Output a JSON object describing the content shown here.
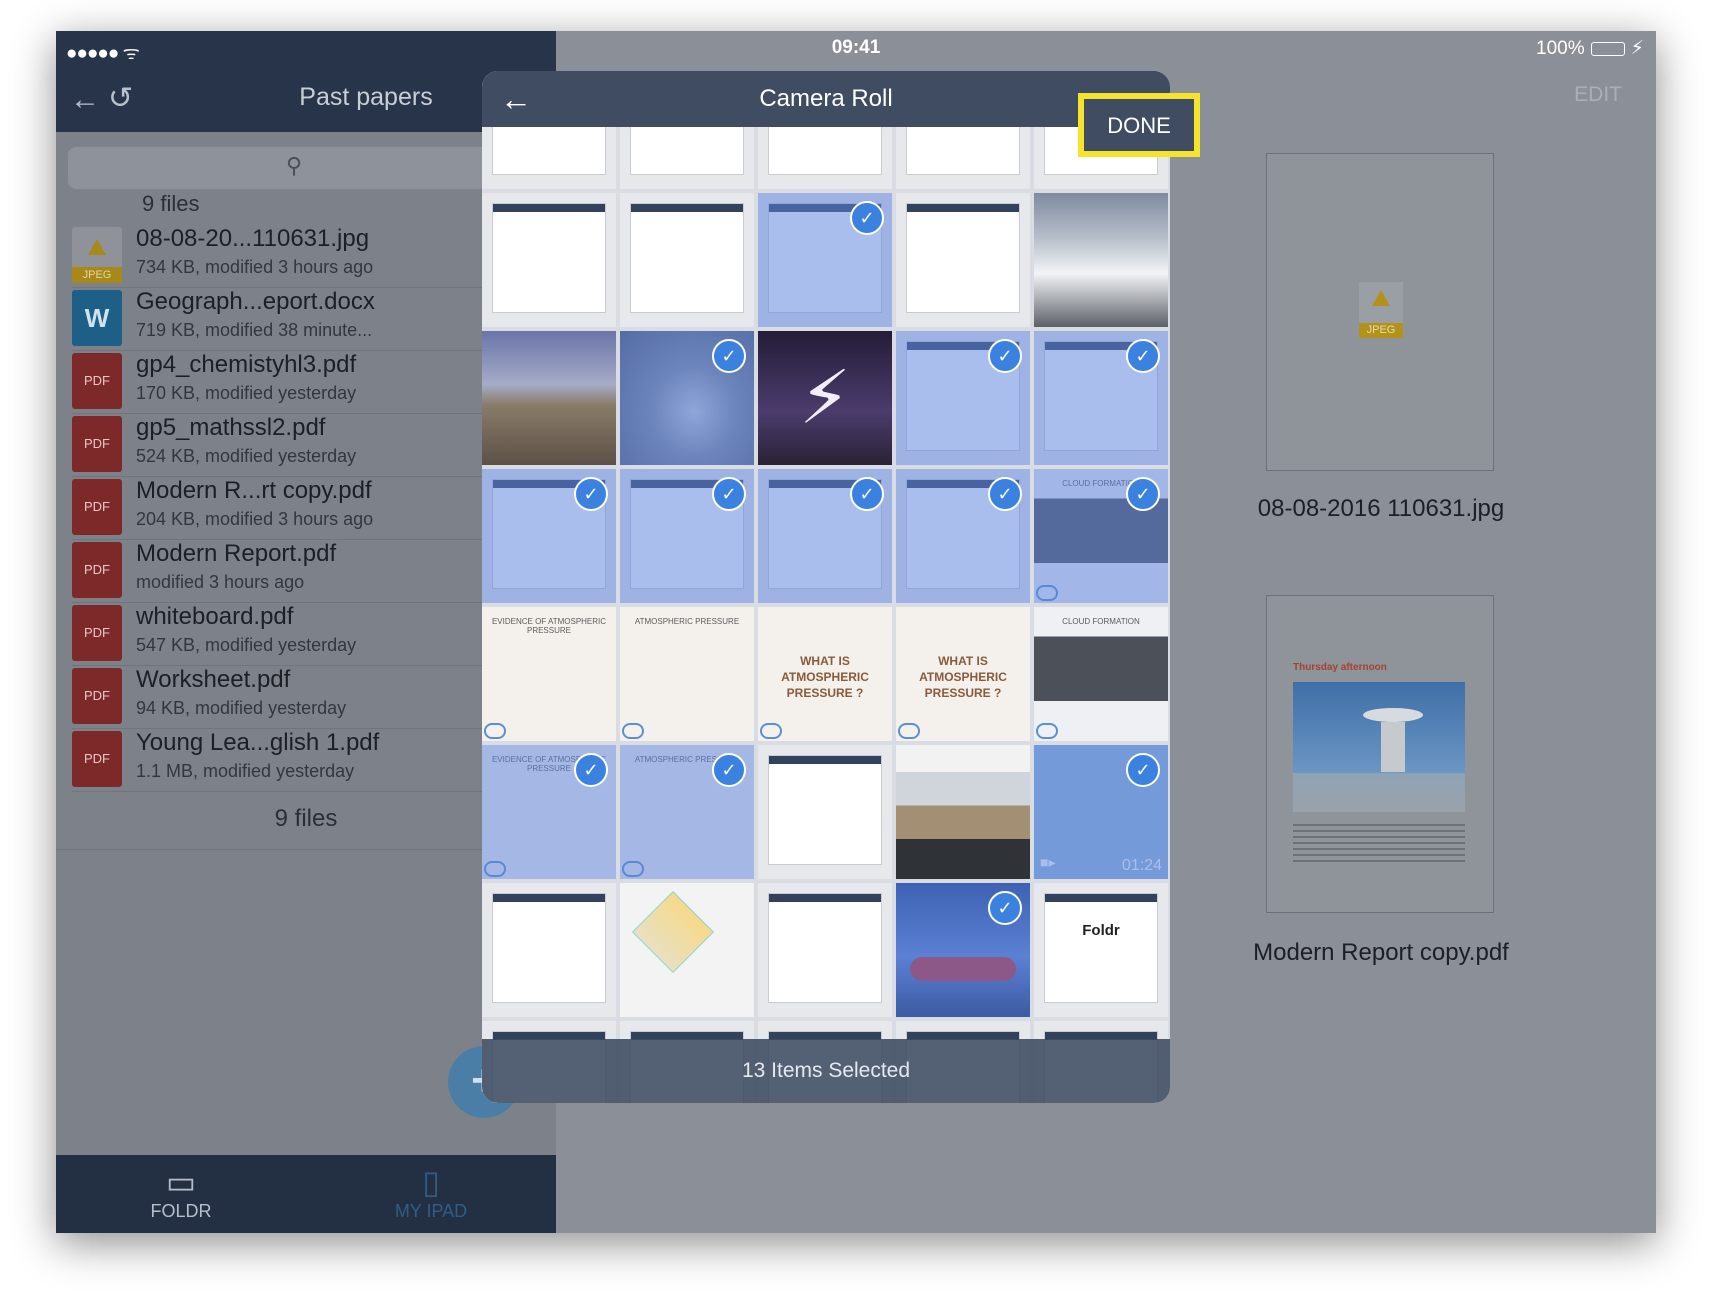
{
  "status": {
    "signal": "●●●●● ᯤ",
    "time": "09:41",
    "battery": "100%"
  },
  "left": {
    "title": "Past papers",
    "count_top": "9 files",
    "count_bottom": "9 files",
    "files": [
      {
        "name": "08-08-20...110631.jpg",
        "meta": "734 KB, modified 3 hours ago",
        "type": "jpeg",
        "icon_text": "JPEG"
      },
      {
        "name": "Geograph...eport.docx",
        "meta": "719 KB, modified 38 minute...",
        "type": "word",
        "icon_text": "W"
      },
      {
        "name": "gp4_chemistyhl3.pdf",
        "meta": "170 KB, modified yesterday",
        "type": "pdf",
        "icon_text": "PDF"
      },
      {
        "name": "gp5_mathssl2.pdf",
        "meta": "524 KB, modified yesterday",
        "type": "pdf",
        "icon_text": "PDF"
      },
      {
        "name": "Modern R...rt copy.pdf",
        "meta": "204 KB, modified 3 hours ago",
        "type": "pdf",
        "icon_text": "PDF"
      },
      {
        "name": "Modern Report.pdf",
        "meta": "modified 3 hours ago",
        "type": "pdf",
        "icon_text": "PDF"
      },
      {
        "name": "whiteboard.pdf",
        "meta": "547 KB, modified yesterday",
        "type": "pdf",
        "icon_text": "PDF"
      },
      {
        "name": "Worksheet.pdf",
        "meta": "94 KB, modified yesterday",
        "type": "pdf",
        "icon_text": "PDF"
      },
      {
        "name": "Young Lea...glish 1.pdf",
        "meta": "1.1 MB, modified yesterday",
        "type": "pdf",
        "icon_text": "PDF"
      }
    ],
    "tabs": [
      {
        "label": "FOLDR",
        "icon": "folder-icon"
      },
      {
        "label": "MY IPAD",
        "icon": "ipad-icon"
      }
    ],
    "fab": "+"
  },
  "right": {
    "edit_label": "EDIT",
    "previews": [
      {
        "caption": "08-08-2016 110631.jpg",
        "icon_text": "JPEG"
      },
      {
        "caption": "Modern Report copy.pdf",
        "heading": "Thursday afternoon"
      }
    ]
  },
  "modal": {
    "title": "Camera Roll",
    "done_label": "DONE",
    "selected_text": "13 Items Selected",
    "grid": {
      "columns": 5,
      "cells": [
        {
          "kind": "screenshot",
          "selected": false
        },
        {
          "kind": "screenshot",
          "selected": false
        },
        {
          "kind": "screenshot",
          "selected": false
        },
        {
          "kind": "screenshot",
          "selected": false
        },
        {
          "kind": "screenshot",
          "selected": false
        },
        {
          "kind": "screenshot",
          "selected": false
        },
        {
          "kind": "screenshot",
          "selected": false
        },
        {
          "kind": "screenshot",
          "selected": true
        },
        {
          "kind": "screenshot",
          "selected": false
        },
        {
          "kind": "snow",
          "selected": false
        },
        {
          "kind": "desert",
          "selected": false
        },
        {
          "kind": "tornado",
          "selected": true
        },
        {
          "kind": "lightning",
          "selected": false
        },
        {
          "kind": "screenshot",
          "selected": true
        },
        {
          "kind": "screenshot",
          "selected": true
        },
        {
          "kind": "screenshot",
          "selected": true
        },
        {
          "kind": "screenshot",
          "selected": true
        },
        {
          "kind": "screenshot",
          "selected": true
        },
        {
          "kind": "screenshot",
          "selected": true
        },
        {
          "kind": "classroom",
          "selected": true,
          "label": "CLOUD FORMATION"
        },
        {
          "kind": "slide",
          "selected": false,
          "label": "EVIDENCE OF ATMOSPHERIC PRESSURE"
        },
        {
          "kind": "slide",
          "selected": false,
          "label": "ATMOSPHERIC PRESSURE"
        },
        {
          "kind": "slide",
          "selected": false,
          "label": "WHAT IS ATMOSPHERIC PRESSURE ?"
        },
        {
          "kind": "slide",
          "selected": false,
          "label": "WHAT IS ATMOSPHERIC PRESSURE ?"
        },
        {
          "kind": "classroom",
          "selected": false,
          "label": "CLOUD FORMATION"
        },
        {
          "kind": "slide",
          "selected": true,
          "label": "EVIDENCE OF ATMOSPHERIC PRESSURE"
        },
        {
          "kind": "slide",
          "selected": true,
          "label": "ATMOSPHERIC PRESSURE"
        },
        {
          "kind": "screenshot",
          "selected": false
        },
        {
          "kind": "house",
          "selected": false
        },
        {
          "kind": "video",
          "selected": true,
          "duration": "01:24"
        },
        {
          "kind": "screenshot",
          "selected": false
        },
        {
          "kind": "drawing",
          "selected": false
        },
        {
          "kind": "screenshot",
          "selected": false
        },
        {
          "kind": "car",
          "selected": true
        },
        {
          "kind": "screenshot",
          "selected": false,
          "label": "Foldr"
        },
        {
          "kind": "screenshot",
          "selected": false
        },
        {
          "kind": "screenshot",
          "selected": false
        },
        {
          "kind": "screenshot",
          "selected": false
        },
        {
          "kind": "screenshot",
          "selected": false
        },
        {
          "kind": "screenshot",
          "selected": false
        }
      ]
    }
  },
  "colors": {
    "nav": "#28344a",
    "modal_header": "#3f4c61",
    "highlight": "#f5e32c",
    "check": "#3b82e0",
    "pdf": "#7d2929"
  }
}
